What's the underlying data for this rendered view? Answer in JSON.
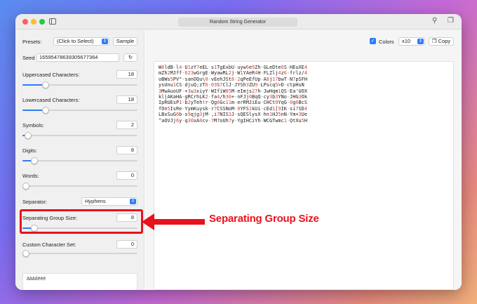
{
  "window": {
    "title": "Random String Generator"
  },
  "sidebar": {
    "presets_label": "Presets:",
    "presets_value": "(Click to Select)",
    "sample_label": "Sample",
    "seed_label": "Seed",
    "seed_value": "16595478639305677364",
    "uppercase": {
      "label": "Uppercased Characters:",
      "value": "18",
      "level": 0.18
    },
    "lowercase": {
      "label": "Lowercased Characters:",
      "value": "18",
      "level": 0.18
    },
    "symbols": {
      "label": "Symbols:",
      "value": "2",
      "level": 0.02
    },
    "digits": {
      "label": "Digits:",
      "value": "8",
      "level": 0.08
    },
    "words": {
      "label": "Words:",
      "value": "0",
      "level": 0.0
    },
    "separator_label": "Separator:",
    "separator_value": "Hyphens",
    "group_size": {
      "label": "Separating Group Size:",
      "value": "8",
      "level": 0.08
    },
    "custom_charset": {
      "label": "Custom Character Set:",
      "value": "0",
      "level": 0.0,
      "text": "āāādēēē"
    }
  },
  "toolbar": {
    "colors_label": "Colors",
    "multiplier_value": "x10",
    "copy_label": "Copy"
  },
  "output": {
    "lines": [
      "W8ldB-l4-U1zY7eEL-s1TgExbU-uyw6e9Zh-GLeDte6S-HEuXE4",
      "mZh2MJff-623wGrgE-WyawRL2j-W1YAeR4H-FLZlj4z6-frlz/4",
      "oBWs5PV\"-sanOQu\\0-vEehJSt8-2qPeEfUp-A8j17bwT-N7pSFH",
      "ysUnu1CS-djuQ;zT6-03S7ClJ-JYSh3ZU9-LPscq5>D-ctpHsN",
      "3MwAuoUF-+3u3xiyY-WIfiW85M-eImjs27h-JwHqm1QS-Ea'UOX",
      "kljAKaHA-gRCrhLK2-fa4/h30+-nFJj0BqQ-cy3b3YNo-JHG3Ok",
      "IpRUEsP1-b2yTeh!r-Qg6Gc11m-erRMJiEu-CHCt0YqG-0g6BcS",
      "fOn5IsRe-YymKuysk-r7CSSNoM-0YFS1kUi-cEd1[9IK-si7SD4",
      "LBxSuG6b-s9qjg3jM-,i7NIS3J-sQESlysX-hn1HJ5nN-Ym+3Ue",
      "^aOVJj6y-q30xA0cv-7M?oUh7y-YgIHCiYh-WCGTwmc1-QtXu5H"
    ]
  },
  "annotation": {
    "callout_text": "Separating Group Size"
  },
  "colors": {
    "accent": "#2f7cf6",
    "highlight": "#e8121c"
  }
}
